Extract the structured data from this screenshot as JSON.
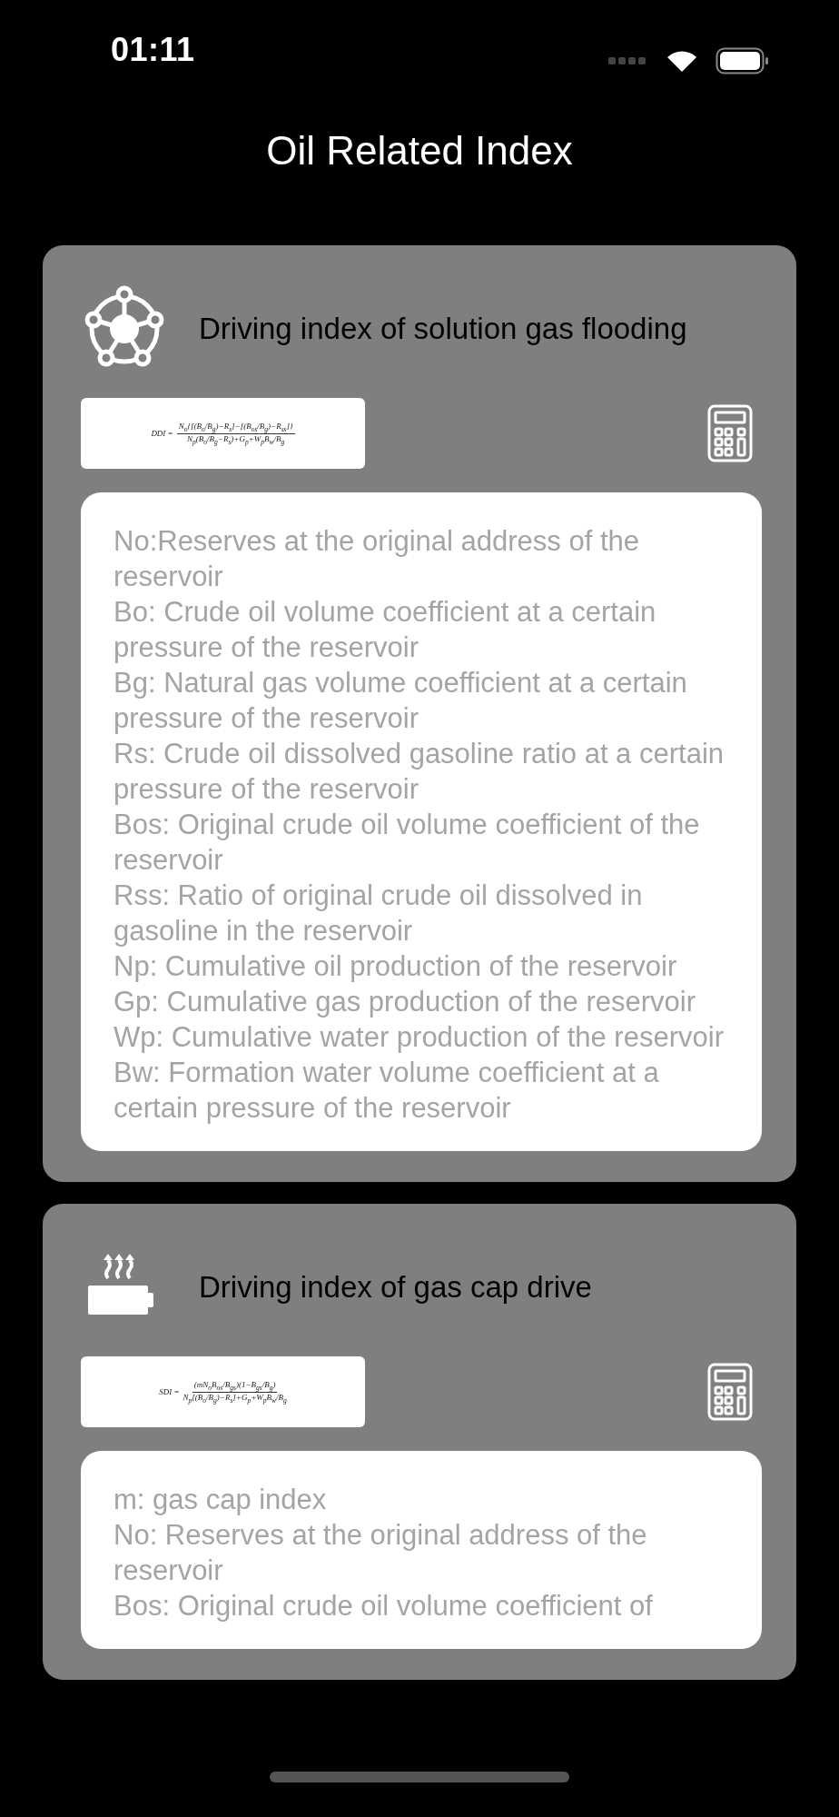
{
  "status_bar": {
    "time": "01:11"
  },
  "title": "Oil Related Index",
  "cards": [
    {
      "kind": "network",
      "title": "Driving index of solution gas flooding",
      "formula": {
        "lhs": "DDI =",
        "numerator": "N$_{o}${[(B$_{o}$/B$_{g}$)−R$_{s}$]−[(B$_{os}$/B$_{g}$)−R$_{ss}$]}",
        "denominator": "N$_{p}$(B$_{o}$/B$_{g}$−R$_{s}$)+G$_{p}$+W$_{p}$B$_{w}$/B$_{g}$"
      },
      "lines": [
        "No:Reserves at the original address of the reservoir",
        "Bo: Crude oil volume coefficient at a certain pressure of the reservoir",
        "Bg: Natural gas volume coefficient at a certain pressure of the reservoir",
        "Rs: Crude oil dissolved gasoline ratio at a certain pressure of the reservoir",
        "Bos: Original crude oil volume coefficient of the reservoir",
        "Rss: Ratio of original crude oil dissolved in gasoline in the reservoir",
        "Np: Cumulative oil production of the reservoir",
        "Gp: Cumulative gas production of the reservoir",
        "Wp: Cumulative water production of the reservoir",
        "Bw: Formation water volume coefficient at a",
        "certain pressure of the reservoir"
      ]
    },
    {
      "kind": "heater",
      "title": "Driving index of gas cap drive",
      "formula": {
        "lhs": "SDI =",
        "numerator": "(mN$_{o}$B$_{os}$/B$_{gs}$)(1−B$_{gs}$/B$_{g}$)",
        "denominator": "N$_{p}$[(B$_{o}$/B$_{g}$)−R$_{s}$]+G$_{p}$+W$_{p}$B$_{w}$/B$_{g}$"
      },
      "lines": [
        "m: gas cap index",
        "No: Reserves at the original address of the reservoir",
        "Bos: Original crude oil volume coefficient of"
      ]
    }
  ]
}
